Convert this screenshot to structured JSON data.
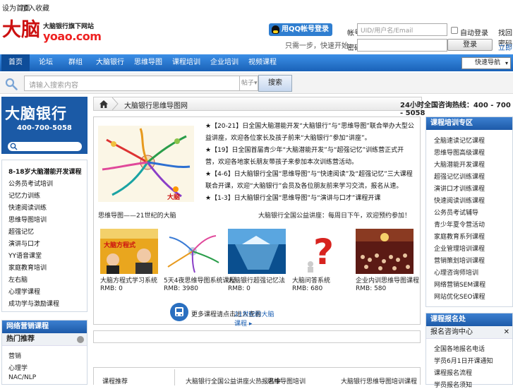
{
  "topbar": {
    "home": "设为首页",
    "fav": "加入收藏"
  },
  "logo": {
    "brand": "大脑",
    "tagline": "大脑银行旗下网站",
    "url": "yoao.com"
  },
  "login": {
    "qq_button": "用QQ帐号登录",
    "qq_sub": "只需一步，快速开始",
    "account_label": "帐号",
    "account_placeholder": "UID/用户名/Email",
    "password_label": "密码",
    "auto_login": "自动登录",
    "login_button": "登录",
    "find_password": "找回密码",
    "register": "立即注册"
  },
  "nav": {
    "items": [
      "首页",
      "论坛",
      "群组",
      "大脑银行",
      "思维导图",
      "课程培训",
      "企业培训",
      "视频课程"
    ],
    "select": "快速导航"
  },
  "search": {
    "placeholder": "请输入搜索内容",
    "type": "帖子",
    "button": "搜索"
  },
  "left": {
    "brand_title": "大脑银行",
    "brand_phone": "400-700-5058",
    "list": [
      "8-18岁大脑潜能开发课程",
      "公务员考试培训",
      "记忆力训练",
      "快速阅读训练",
      "思维导图培训",
      "超强记忆",
      "演讲与口才",
      "YY语音课堂",
      "家庭教育培训",
      "左右脑",
      "心理学课程",
      "成功学与激励课程"
    ],
    "box2_title": "网络营销课程",
    "box2_sub": "热门推荐",
    "box2_items": [
      "营销",
      "心理学",
      "NAC/NLP"
    ]
  },
  "breadcrumb": {
    "text": "大脑银行思维导图网",
    "hotline": "24小时全国咨询热线：400 - 700 - 5058"
  },
  "main": {
    "mindmap_caption": "思维导图——21世纪的大脑",
    "news": [
      "★【20-21】日全国大脑潜能开发“大脑银行”与“思维导图”联合举办大型公益讲座，欢迎各位家长及孩子前来“大脑银行”参加“讲座”。",
      "★【19】日全国首届青少年“大脑潜能开发”与“超强记忆”训练营正式开营，欢迎各地家长朋友带孩子来参加本次训练营活动。",
      "★【4-6】日大脑银行全国“思维导图”与“快速阅读”及“超强记忆”三大课程联合开课，欢迎“大脑银行”会员及各位朋友前来学习交流，报名从速。",
      "★【1-3】日大脑银行全国“思维导图”与“演讲与口才”课程开课"
    ],
    "news_sub": "大脑银行全国公益讲座：每周日下午，欢迎预约参加！",
    "products": [
      {
        "name": "大脑方程式学习系统",
        "price": "RMB: 0"
      },
      {
        "name": "5天4夜思维导图系统课程",
        "price": "RMB: 3980"
      },
      {
        "name": "大脑银行超强记忆法",
        "price": "RMB: 0"
      },
      {
        "name": "大脑问答系统",
        "price": "RMB: 680"
      },
      {
        "name": "企业内训思维导图课程",
        "price": "RMB: 580"
      }
    ],
    "more_text": "更多课程请点击进入查看",
    "more_link": "21世纪的大脑课程"
  },
  "bottom": [
    "课程推荐",
    "大脑银行全国公益讲座火热报名中",
    "思维导图培训",
    "大脑银行思维导图培训课程"
  ],
  "right": {
    "box1_title": "课程培训专区",
    "box1_items": [
      "全脑速读记忆课程",
      "思维导图高级课程",
      "大脑潜能开发课程",
      "超强记忆训练课程",
      "演讲口才训练课程",
      "快速阅读训练课程",
      "公务员考试辅导",
      "青少年夏令营活动",
      "家庭教育系列课程",
      "企业管理培训课程",
      "营销策划培训课程",
      "心理咨询师培训",
      "网络营销SEM课程",
      "网站优化SEO课程"
    ],
    "box2_title": "课程报名处",
    "box2_sub": "报名咨询中心",
    "box2_items": [
      "全国各地报名电话",
      "学员6月1日开课通知",
      "课程报名流程",
      "学员报名须知"
    ]
  },
  "colors": {
    "nav_blue": "#1a62b8",
    "brand_red": "#cc1111",
    "box_blue": "#1d5aa8"
  }
}
